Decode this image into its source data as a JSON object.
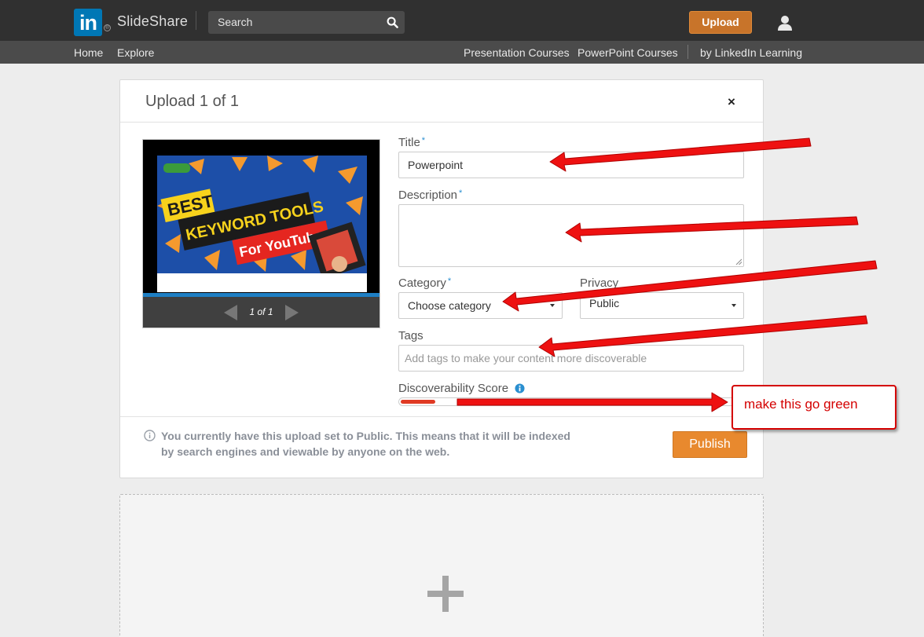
{
  "nav": {
    "logo_text": "in",
    "brand": "SlideShare",
    "search_placeholder": "Search",
    "upload_label": "Upload",
    "sub_left": [
      "Home",
      "Explore"
    ],
    "sub_right": [
      "Presentation Courses",
      "PowerPoint Courses",
      "by LinkedIn Learning"
    ]
  },
  "dialog": {
    "title": "Upload 1 of 1",
    "close": "×",
    "preview": {
      "pager": "1 of 1",
      "thumb_lines": [
        "BEST",
        "KEYWORD TOOLS",
        "For YouTube"
      ]
    },
    "fields": {
      "title_label": "Title",
      "title_value": "Powerpoint",
      "description_label": "Description",
      "category_label": "Category",
      "category_value": "Choose category",
      "privacy_label": "Privacy",
      "privacy_value": "Public",
      "tags_label": "Tags",
      "tags_placeholder": "Add tags to make your content more discoverable",
      "required_mark": "*"
    },
    "discoverability": {
      "label": "Discoverability Score",
      "score_fraction": 0.1,
      "bar_color": "#e03a24"
    },
    "notice": "You currently have this upload set to Public. This means that it will be indexed by search engines and viewable by anyone on the web.",
    "publish_label": "Publish"
  },
  "dropzone": {
    "icon": "plus-icon"
  },
  "annotation": {
    "callout_text": "make this go green",
    "color": "#ff0000"
  },
  "colors": {
    "linkedin_blue": "#0077b5",
    "upload_orange": "#c8742a",
    "publish_orange": "#e8892e",
    "required_blue": "#2a8fd0"
  }
}
